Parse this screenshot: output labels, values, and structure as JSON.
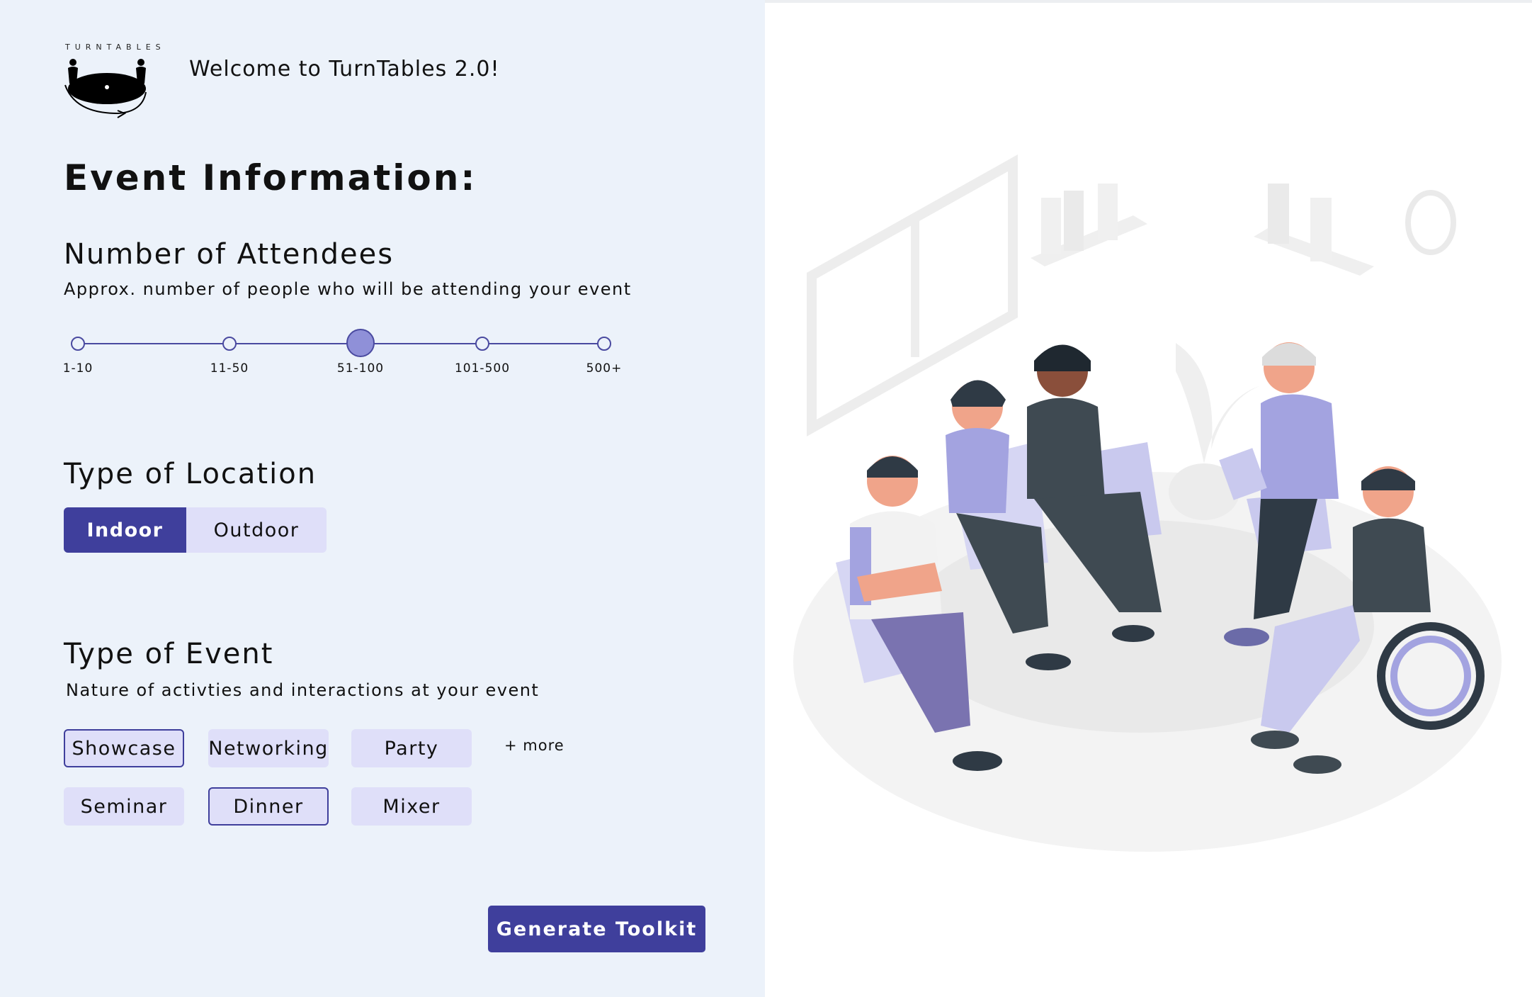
{
  "header": {
    "logo_text": "TURNTABLES",
    "welcome": "Welcome to TurnTables 2.0!"
  },
  "page": {
    "title": "Event Information:"
  },
  "attendees": {
    "title": "Number of Attendees",
    "subtitle": "Approx. number of people who will be attending your event",
    "options": [
      "1-10",
      "11-50",
      "51-100",
      "101-500",
      "500+"
    ],
    "selected": "51-100"
  },
  "location": {
    "title": "Type of Location",
    "options": [
      "Indoor",
      "Outdoor"
    ],
    "selected": "Indoor"
  },
  "event_type": {
    "title": "Type of Event",
    "subtitle": "Nature of activties and interactions at your event",
    "chips": [
      "Showcase",
      "Networking",
      "Party",
      "Seminar",
      "Dinner",
      "Mixer"
    ],
    "selected": [
      "Showcase",
      "Dinner"
    ],
    "more_label": "+ more"
  },
  "actions": {
    "generate_label": "Generate Toolkit"
  },
  "colors": {
    "accent": "#3f3f9c",
    "chip_bg": "#dfdff9",
    "panel_bg": "#ecf2fa",
    "slider_active": "#8f90d8"
  },
  "illustration": {
    "icon": "people-discussion-illustration"
  }
}
